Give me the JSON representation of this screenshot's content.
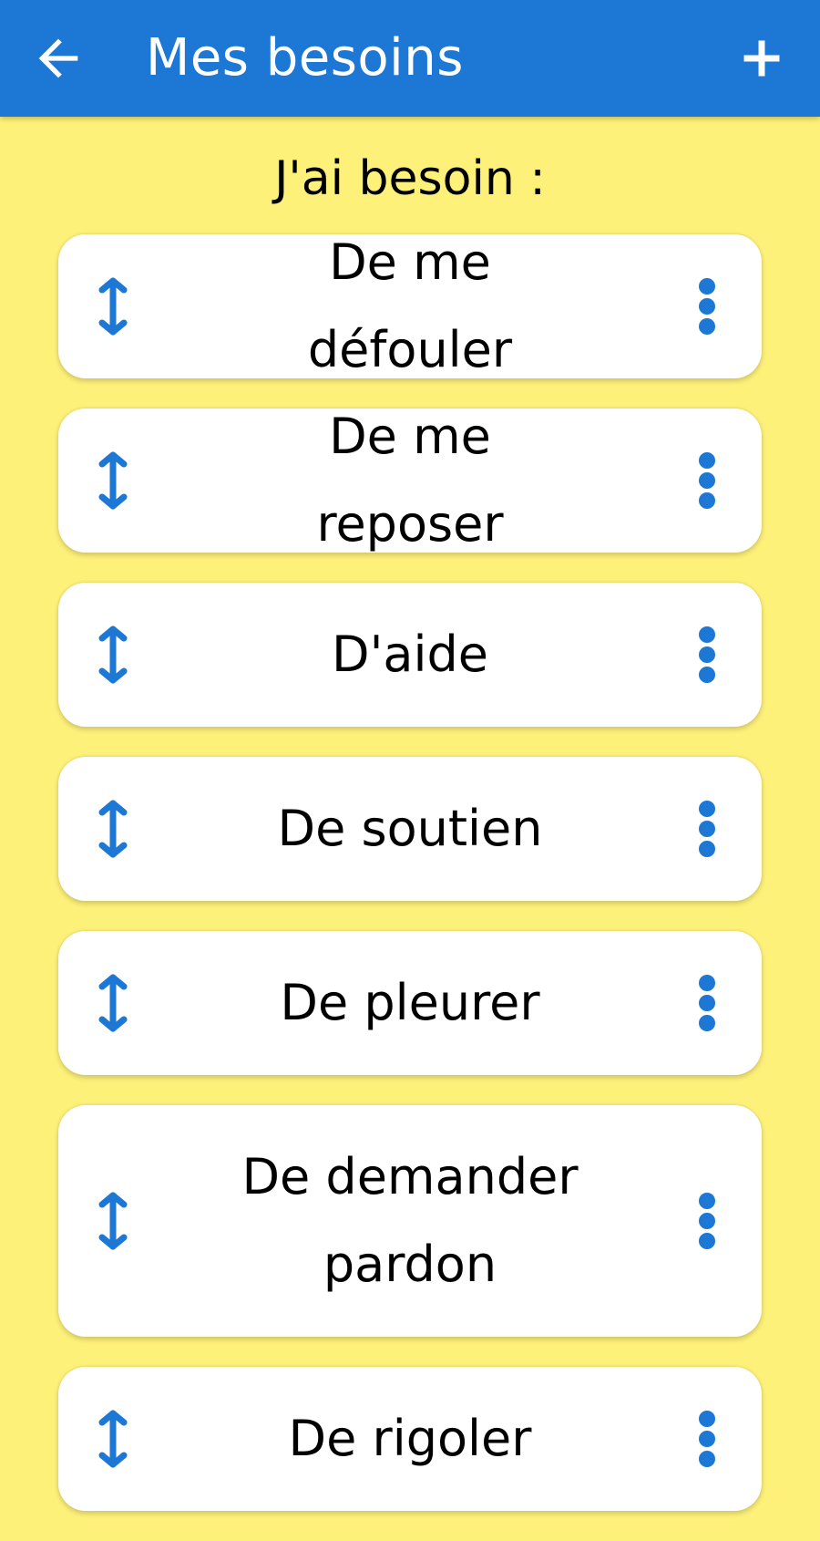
{
  "app_bar": {
    "title": "Mes besoins",
    "back_icon": "arrow-left-icon",
    "add_icon": "plus-icon",
    "color": "#1D77D4"
  },
  "heading": "J'ai besoin :",
  "background_color": "#FEF179",
  "accent_color": "#1D77D4",
  "needs": [
    {
      "label": "De me défouler"
    },
    {
      "label": "De me reposer"
    },
    {
      "label": "D'aide"
    },
    {
      "label": "De soutien"
    },
    {
      "label": "De pleurer"
    },
    {
      "label": "De demander pardon"
    },
    {
      "label": "De rigoler"
    }
  ],
  "item_icons": {
    "reorder": "vertical-arrows-icon",
    "menu": "more-vert-icon"
  }
}
